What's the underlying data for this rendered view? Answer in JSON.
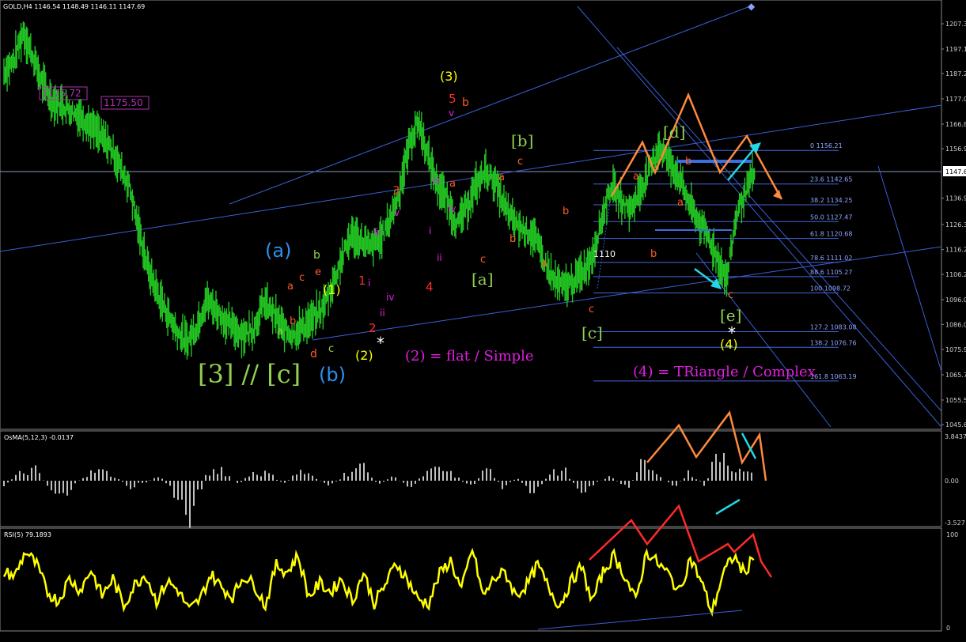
{
  "main_panel": {
    "symbol_header": "GOLD,H4  1146.54 1148.49 1146.11 1147.69",
    "price_axis_ticks": [
      "1207.3",
      "1197.1",
      "1187.2",
      "1177.0",
      "1166.8",
      "1156.9",
      "1136.9",
      "1126.3",
      "1116.2",
      "1106.2",
      "1096.0",
      "1086.0",
      "1075.9",
      "1065.7",
      "1055.5",
      "1045.6"
    ],
    "current_price_label": "1147.69",
    "price_tags": [
      "1175.72",
      "1175.50"
    ],
    "fib_levels": [
      {
        "label": "0 1156.21",
        "price": 1156.21
      },
      {
        "label": "23.6 1142.65",
        "price": 1142.65
      },
      {
        "label": "38.2 1134.25",
        "price": 1134.25
      },
      {
        "label": "50.0 1127.47",
        "price": 1127.47
      },
      {
        "label": "61.8 1120.68",
        "price": 1120.68
      },
      {
        "label": "78.6 1111.02",
        "price": 1111.02
      },
      {
        "label": "88.6 1105.27",
        "price": 1105.27
      },
      {
        "label": "100 1098.72",
        "price": 1098.72
      },
      {
        "label": "127.2 1083.08",
        "price": 1083.08
      },
      {
        "label": "138.2 1076.76",
        "price": 1076.76
      },
      {
        "label": "161.8 1063.19",
        "price": 1063.19
      }
    ],
    "level_1110": "1110",
    "notes": {
      "wave2": "(2) = flat / Simple",
      "wave4": "(4) = TRiangle / Complex",
      "degree_3c": "[3] // [c]"
    },
    "wave_labels": {
      "paren_a": "(a)",
      "paren_b": "(b)",
      "p1": "(1)",
      "p2": "(2)",
      "p3": "(3)",
      "p4": "(4)",
      "bk_a": "[a]",
      "bk_b": "[b]",
      "bk_c": "[c]",
      "bk_d": "[d]",
      "bk_e": "[e]",
      "a": "a",
      "b": "b",
      "c": "c",
      "d": "d",
      "e": "e",
      "i": "i",
      "ii": "ii",
      "iii": "iii",
      "iv": "iv",
      "v": "v",
      "n1": "1",
      "n2": "2",
      "n3": "3",
      "n4": "4",
      "n5": "5",
      "star": "*"
    }
  },
  "osma_panel": {
    "header": "OsMA(5,12,3) -0.0137",
    "ticks": [
      "3.8437",
      "0.00",
      "-3.527"
    ]
  },
  "rsi_panel": {
    "header": "RSI(5) 79.1893",
    "ticks": [
      "100",
      "0"
    ]
  },
  "colors": {
    "candles": "#22c322",
    "trendline": "#3a5fd6",
    "fib": "#4466dd",
    "orange": "#ff8a3d",
    "cyan": "#22d8e8",
    "red": "#ff2a2a",
    "yellow": "#ffff00",
    "osma": "#c0c0c0",
    "magenta": "#e020e0",
    "lime": "#8fd14f",
    "waveblue": "#2e8ff0"
  },
  "chart_data": [
    {
      "type": "line",
      "title": "GOLD,H4",
      "ylim": [
        1045.6,
        1207.3
      ],
      "series": [
        {
          "name": "GOLD,H4",
          "values": [
            1188,
            1192,
            1204,
            1194,
            1183,
            1176,
            1175,
            1172,
            1170,
            1166,
            1162,
            1158,
            1150,
            1142,
            1124,
            1108,
            1098,
            1090,
            1083,
            1079,
            1085,
            1096,
            1092,
            1087,
            1084,
            1082,
            1085,
            1095,
            1090,
            1084,
            1082,
            1085,
            1088,
            1092,
            1101,
            1112,
            1122,
            1120,
            1117,
            1120,
            1128,
            1139,
            1158,
            1168,
            1154,
            1142,
            1136,
            1126,
            1133,
            1142,
            1148,
            1143,
            1133,
            1127,
            1124,
            1122,
            1112,
            1104,
            1101,
            1103,
            1107,
            1113,
            1128,
            1142,
            1136,
            1132,
            1140,
            1148,
            1158,
            1152,
            1146,
            1136,
            1128,
            1122,
            1113,
            1104,
            1130,
            1140,
            1148
          ]
        }
      ]
    },
    {
      "type": "bar",
      "title": "OsMA(5,12,3) -0.0137",
      "ylim": [
        -3.527,
        3.8437
      ],
      "series": [
        {
          "name": "OsMA",
          "values": [
            -0.4,
            0.6,
            1.0,
            -0.8,
            -1.1,
            0.3,
            0.9,
            0.5,
            -0.6,
            -0.2,
            0.4,
            -1.3,
            -2.9,
            0.5,
            1.1,
            -0.4,
            0.8,
            0.6,
            -0.3,
            0.9,
            0.2,
            -0.5,
            0.7,
            1.3,
            -0.4,
            0.5,
            -0.8,
            0.6,
            1.0,
            0.4,
            -0.6,
            1.2,
            -0.5,
            0.3,
            -1.6,
            0.6,
            0.9,
            -0.9,
            -0.2,
            0.4,
            -0.8,
            1.5,
            0.4,
            -0.6,
            0.7,
            -0.4,
            3.0,
            0.9,
            0.5
          ]
        }
      ]
    },
    {
      "type": "line",
      "title": "RSI(5) 79.1893",
      "ylim": [
        0,
        100
      ],
      "series": [
        {
          "name": "RSI(5)",
          "values": [
            62,
            58,
            85,
            70,
            40,
            30,
            55,
            42,
            65,
            36,
            55,
            25,
            48,
            60,
            30,
            52,
            42,
            20,
            32,
            60,
            45,
            35,
            58,
            48,
            25,
            70,
            62,
            80,
            35,
            50,
            40,
            55,
            30,
            62,
            28,
            48,
            72,
            55,
            32,
            28,
            60,
            75,
            42,
            88,
            35,
            55,
            62,
            36,
            48,
            70,
            45,
            25,
            50,
            68,
            30,
            62,
            80,
            58,
            30,
            85,
            72,
            60,
            40,
            78,
            52,
            18,
            60,
            80,
            60,
            86
          ]
        }
      ]
    }
  ]
}
